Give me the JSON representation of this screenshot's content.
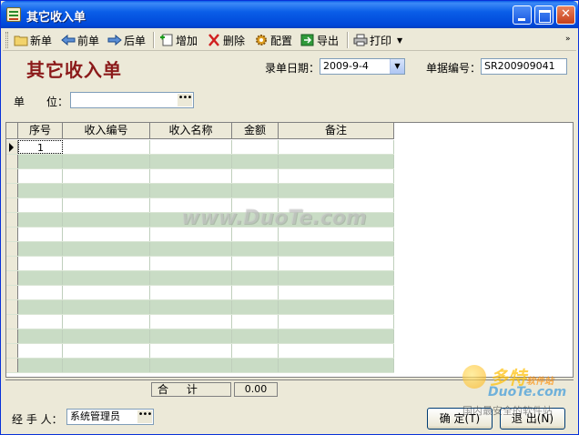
{
  "window": {
    "title": "其它收入单"
  },
  "toolbar": {
    "new_label": "新单",
    "prev_label": "前单",
    "next_label": "后单",
    "add_label": "增加",
    "delete_label": "删除",
    "config_label": "配置",
    "export_label": "导出",
    "print_label": "打印"
  },
  "form": {
    "title": "其它收入单",
    "date_label": "录单日期：",
    "date_value": "2009-9-4",
    "doc_no_label": "单据编号：",
    "doc_no_value": "SR200909041",
    "unit_label": "单　　位：",
    "unit_value": ""
  },
  "grid": {
    "columns": [
      "序号",
      "收入编号",
      "收入名称",
      "金额",
      "备注"
    ],
    "rows": [
      {
        "seq": "1",
        "code": "",
        "name": "",
        "amount": "",
        "note": ""
      }
    ]
  },
  "totals": {
    "label": "合 计",
    "value": "0.00"
  },
  "footer": {
    "handler_label": "经 手 人：",
    "handler_value": "系统管理员",
    "ok_label": "确 定(T)",
    "exit_label": "退 出(N)"
  },
  "watermark": {
    "site": "www.DuoTe.com",
    "logo_cn": "多特",
    "logo_small": "软件站",
    "logo_en": "DuoTe.com",
    "slogan": "国内最安全的软件站"
  }
}
